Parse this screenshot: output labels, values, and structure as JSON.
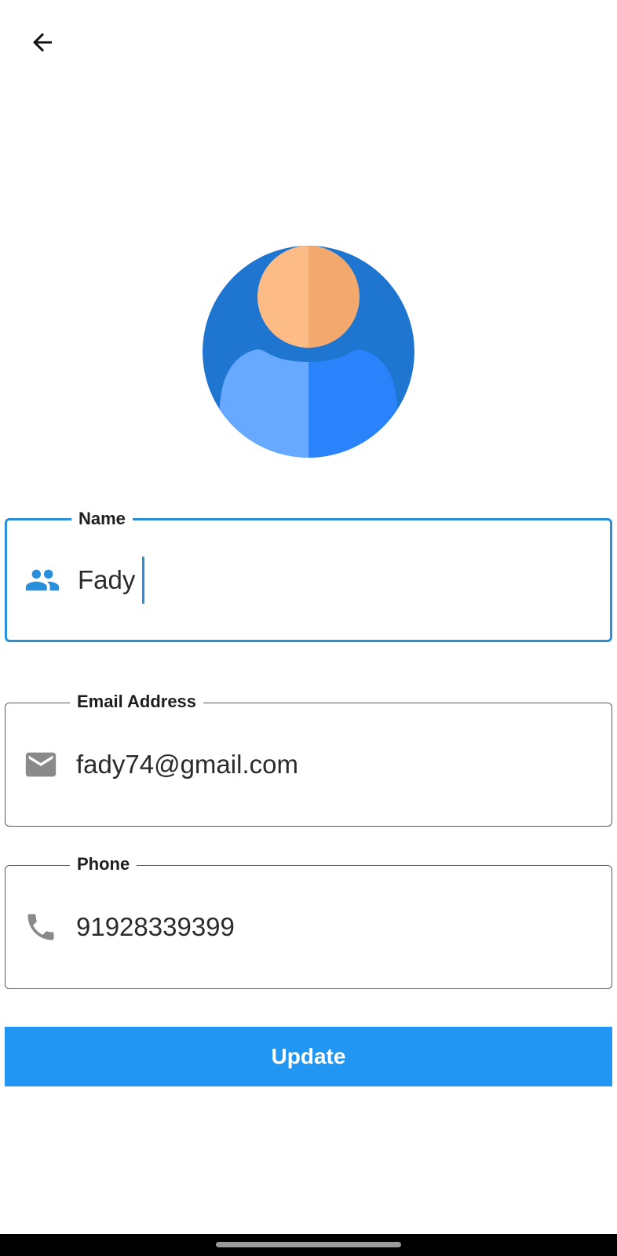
{
  "header": {
    "back_icon": "arrow-left-icon"
  },
  "avatar": {
    "icon": "user-avatar-icon"
  },
  "form": {
    "name": {
      "label": "Name",
      "value": "Fady",
      "icon": "people-icon",
      "focused": true
    },
    "email": {
      "label": "Email Address",
      "value": "fady74@gmail.com",
      "icon": "mail-icon"
    },
    "phone": {
      "label": "Phone",
      "value": "91928339399",
      "icon": "phone-icon"
    }
  },
  "actions": {
    "update_label": "Update"
  },
  "colors": {
    "accent": "#2196f3",
    "focus_border": "#2a8fdb",
    "avatar_bg": "#1e76d0",
    "avatar_face_light": "#fdbb85",
    "avatar_face_shade": "#f3a96e",
    "avatar_body_light": "#66a9ff",
    "avatar_body_dark": "#2a83fb"
  }
}
